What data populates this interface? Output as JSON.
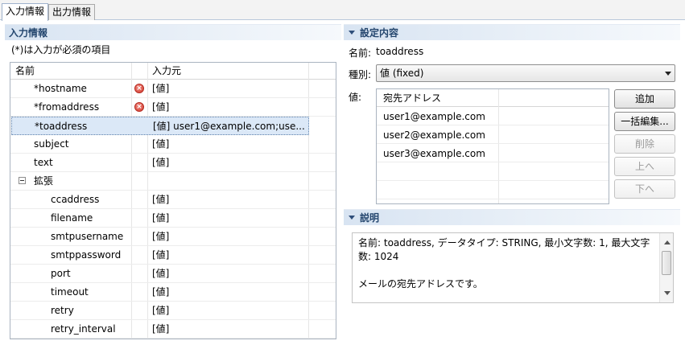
{
  "tabs": [
    {
      "label": "入力情報"
    },
    {
      "label": "出力情報"
    }
  ],
  "left": {
    "section_title": "入力情報",
    "note": "(*)は入力が必須の項目",
    "table": {
      "col_name": "名前",
      "col_value": "入力元",
      "rows": [
        {
          "name": "*hostname",
          "value": "[値]",
          "error": true
        },
        {
          "name": "*fromaddress",
          "value": "[値]",
          "error": true
        },
        {
          "name": "*toaddress",
          "value": "[値] user1@example.com;use...",
          "selected": true
        },
        {
          "name": "subject",
          "value": "[値]"
        },
        {
          "name": "text",
          "value": "[値]"
        },
        {
          "name": "拡張",
          "value": "",
          "group": true
        },
        {
          "name": "ccaddress",
          "value": "[値]"
        },
        {
          "name": "filename",
          "value": "[値]"
        },
        {
          "name": "smtpusername",
          "value": "[値]"
        },
        {
          "name": "smtppassword",
          "value": "[値]"
        },
        {
          "name": "port",
          "value": "[値]"
        },
        {
          "name": "timeout",
          "value": "[値]"
        },
        {
          "name": "retry",
          "value": "[値]"
        },
        {
          "name": "retry_interval",
          "value": "[値]"
        }
      ]
    }
  },
  "settings": {
    "section_title": "設定内容",
    "name_label": "名前:",
    "name_value": "toaddress",
    "type_label": "種別:",
    "type_value": "値 (fixed)",
    "value_label": "値:",
    "address_header": "宛先アドレス",
    "addresses": [
      "user1@example.com",
      "user2@example.com",
      "user3@example.com"
    ],
    "buttons": {
      "add": "追加",
      "bulk_edit": "一括編集...",
      "delete": "削除",
      "up": "上へ",
      "down": "下へ"
    }
  },
  "description": {
    "section_title": "説明",
    "line1": "名前: toaddress, データタイプ: STRING, 最小文字数: 1, 最大文字数: 1024",
    "line2": "メールの宛先アドレスです。"
  },
  "colors": {
    "section_title": "#24466e",
    "selection": "#dbe8f7",
    "error": "#d23b2e"
  }
}
